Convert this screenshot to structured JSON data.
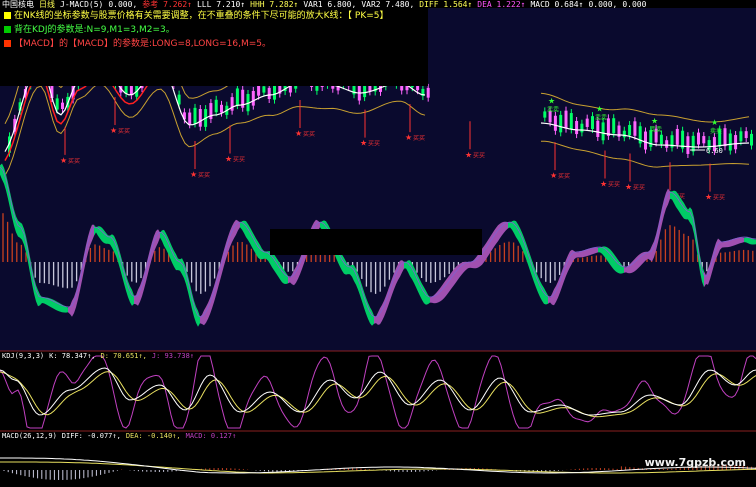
{
  "main_header": {
    "stock_name": "中国核电",
    "period_tag": "日线",
    "indicator": "J-MACD(5)",
    "items": [
      {
        "text": "0.000,",
        "color": "#ffffff"
      },
      {
        "text": "参考 7.262↑",
        "color": "#ff3333"
      },
      {
        "text": "LLL 7.210↑",
        "color": "#ffffff"
      },
      {
        "text": "HHH 7.282↑",
        "color": "#ffff55"
      },
      {
        "text": "VAR1 6.800,",
        "color": "#ffffff"
      },
      {
        "text": "VAR2 7.480,",
        "color": "#ffffff"
      },
      {
        "text": "DIFF 1.564↑",
        "color": "#ffff55"
      },
      {
        "text": "DEA 1.222↑",
        "color": "#ff55ff"
      },
      {
        "text": "MACD 0.684↑",
        "color": "#ffffff"
      },
      {
        "text": "0.000,",
        "color": "#ffffff"
      },
      {
        "text": "0.000",
        "color": "#ffffff"
      }
    ]
  },
  "notes": [
    {
      "text": "在NK线的坐标参数与股票价格有关需要调整，在不重叠的条件下尽可能的放大K线：【 PK=5】",
      "color": "#ffff44",
      "square": "#ffff00"
    },
    {
      "text": "背在KDJ的参数是:N=9,M1=3,M2=3。",
      "color": "#44ff44",
      "square": "#00cc00"
    },
    {
      "text": "【MACD】的【MACD】的参数是:LONG=8,LONG=16,M=5。",
      "color": "#ff4444",
      "square": "#ff3300"
    }
  ],
  "signals": {
    "sell": "卖卖",
    "buy": "买买"
  },
  "price_annotation": "6.60",
  "kdj_header": {
    "label": "KDJ(9,3,3)",
    "k": "K: 78.347↑,",
    "d": "D: 70.651↑,",
    "j": "J: 93.738↑"
  },
  "macd_header": {
    "label": "MACD(26,12,9)",
    "diff": "DIFF: -0.077↑,",
    "dea": "DEA: -0.140↑,",
    "macd": "MACD: 0.127↑"
  },
  "watermark": "www.7gpzb.com",
  "colors": {
    "background": "#000000",
    "main_panel_bg": "#0a0a2e",
    "up_candle": "#ff66ff",
    "down_candle": "#00ff66",
    "band_line": "#c8a030",
    "ma_line": "#ffffff",
    "red_line": "#ff2020",
    "macd_green": "#00cc66",
    "macd_purple": "#a050b0",
    "bar_red": "#c84020",
    "bar_white": "#c8c8dc",
    "k_line": "#ffffff",
    "d_line": "#e8e060",
    "j_line": "#c040c0",
    "divider": "#8a2020"
  }
}
